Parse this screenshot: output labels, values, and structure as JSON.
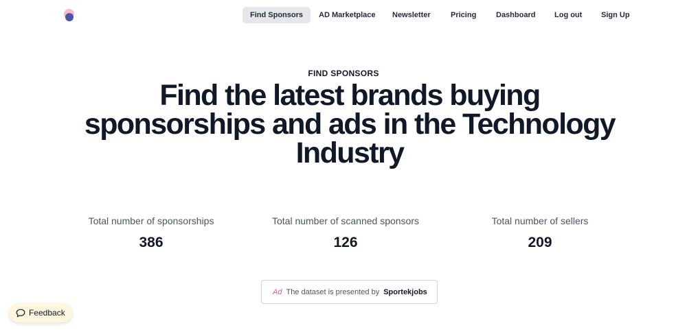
{
  "nav": {
    "items": [
      {
        "label": "Find Sponsors",
        "active": true
      },
      {
        "label": "AD Marketplace"
      },
      {
        "label": "Newsletter"
      },
      {
        "label": "Pricing"
      },
      {
        "label": "Dashboard"
      },
      {
        "label": "Log out"
      },
      {
        "label": "Sign Up"
      }
    ]
  },
  "hero": {
    "eyebrow": "FIND SPONSORS",
    "title": "Find the latest brands buying sponsorships and ads in the Technology Industry"
  },
  "stats": [
    {
      "label": "Total number of sponsorships",
      "value": "386"
    },
    {
      "label": "Total number of scanned sponsors",
      "value": "126"
    },
    {
      "label": "Total number of sellers",
      "value": "209"
    }
  ],
  "ad": {
    "tag": "Ad",
    "text": "The dataset is presented by",
    "sponsor": "Sportekjobs"
  },
  "feedback": {
    "label": "Feedback",
    "icon": "chat-bubble-icon"
  },
  "colors": {
    "accent_pink": "#e0569a",
    "logo_pink": "#f5b3c7",
    "logo_blue": "#4c56a8",
    "active_tab_bg": "#e5e7eb",
    "feedback_bg": "#fdf7e0"
  }
}
